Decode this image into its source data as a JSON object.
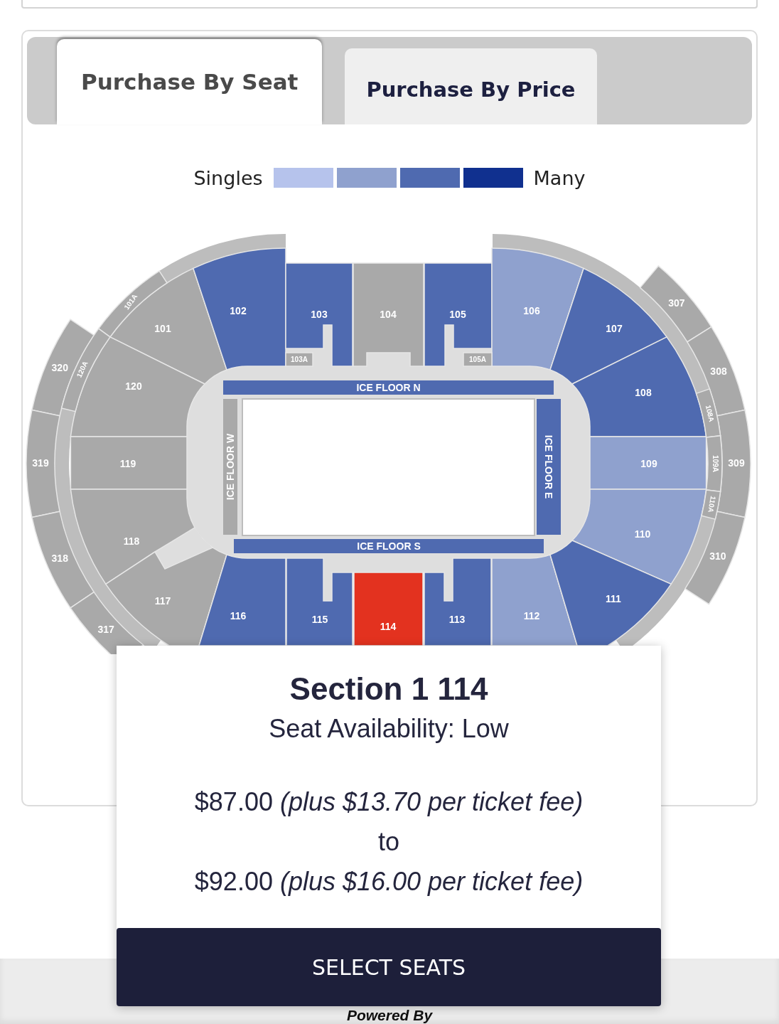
{
  "tabs": [
    {
      "label": "Purchase By Seat",
      "selected": true
    },
    {
      "label": "Purchase By Price",
      "selected": false
    }
  ],
  "legend": {
    "low_label": "Singles",
    "high_label": "Many",
    "swatches": [
      {
        "color": "#b6c3ec"
      },
      {
        "color": "#8fa1ce"
      },
      {
        "color": "#4f6ab0"
      },
      {
        "color": "#10308f"
      }
    ]
  },
  "seat_map": {
    "sections": [
      {
        "label": "101A",
        "color": "#a9a9a9",
        "selected": false
      },
      {
        "label": "101",
        "color": "#a9a9a9",
        "selected": false
      },
      {
        "label": "102",
        "color": "#4f6ab0",
        "selected": false
      },
      {
        "label": "103",
        "color": "#4f6ab0",
        "selected": false
      },
      {
        "label": "103A",
        "color": "#a9a9a9",
        "selected": false
      },
      {
        "label": "104",
        "color": "#a9a9a9",
        "selected": false
      },
      {
        "label": "105",
        "color": "#4f6ab0",
        "selected": false
      },
      {
        "label": "105A",
        "color": "#a9a9a9",
        "selected": false
      },
      {
        "label": "106",
        "color": "#8fa1ce",
        "selected": false
      },
      {
        "label": "107",
        "color": "#4f6ab0",
        "selected": false
      },
      {
        "label": "307",
        "color": "#a9a9a9",
        "selected": false
      },
      {
        "label": "320",
        "color": "#a9a9a9",
        "selected": false
      },
      {
        "label": "120A",
        "color": "#a9a9a9",
        "selected": false
      },
      {
        "label": "120",
        "color": "#a9a9a9",
        "selected": false
      },
      {
        "label": "108",
        "color": "#4f6ab0",
        "selected": false
      },
      {
        "label": "108A",
        "color": "#a9a9a9",
        "selected": false
      },
      {
        "label": "308",
        "color": "#a9a9a9",
        "selected": false
      },
      {
        "label": "319",
        "color": "#a9a9a9",
        "selected": false
      },
      {
        "label": "119",
        "color": "#a9a9a9",
        "selected": false
      },
      {
        "label": "109",
        "color": "#8fa1ce",
        "selected": false
      },
      {
        "label": "109A",
        "color": "#a9a9a9",
        "selected": false
      },
      {
        "label": "309",
        "color": "#a9a9a9",
        "selected": false
      },
      {
        "label": "110A",
        "color": "#a9a9a9",
        "selected": false
      },
      {
        "label": "318",
        "color": "#a9a9a9",
        "selected": false
      },
      {
        "label": "118",
        "color": "#a9a9a9",
        "selected": false
      },
      {
        "label": "110",
        "color": "#8fa1ce",
        "selected": false
      },
      {
        "label": "310",
        "color": "#a9a9a9",
        "selected": false
      },
      {
        "label": "317",
        "color": "#a9a9a9",
        "selected": false
      },
      {
        "label": "117",
        "color": "#a9a9a9",
        "selected": false
      },
      {
        "label": "116",
        "color": "#4f6ab0",
        "selected": false
      },
      {
        "label": "115",
        "color": "#4f6ab0",
        "selected": false
      },
      {
        "label": "114",
        "selected": true
      },
      {
        "label": "113",
        "color": "#4f6ab0",
        "selected": false
      },
      {
        "label": "112",
        "color": "#8fa1ce",
        "selected": false
      },
      {
        "label": "111",
        "color": "#4f6ab0",
        "selected": false
      }
    ],
    "ice_floors": [
      {
        "label": "ICE FLOOR N",
        "color": "#4f6ab0"
      },
      {
        "label": "ICE FLOOR W",
        "color": "#a9a9a9"
      },
      {
        "label": "ICE FLOOR E",
        "color": "#4f6ab0"
      },
      {
        "label": "ICE FLOOR S",
        "color": "#4f6ab0"
      }
    ]
  },
  "popup": {
    "title": "Section 1 114",
    "availability": "Seat Availability: Low",
    "price_lines": [
      "$87.00 *(plus $13.70 per ticket fee)*",
      "to",
      "$92.00 *(plus $16.00 per ticket fee)*"
    ],
    "button": "SELECT SEATS"
  },
  "footer": {
    "text": "Powered By"
  }
}
